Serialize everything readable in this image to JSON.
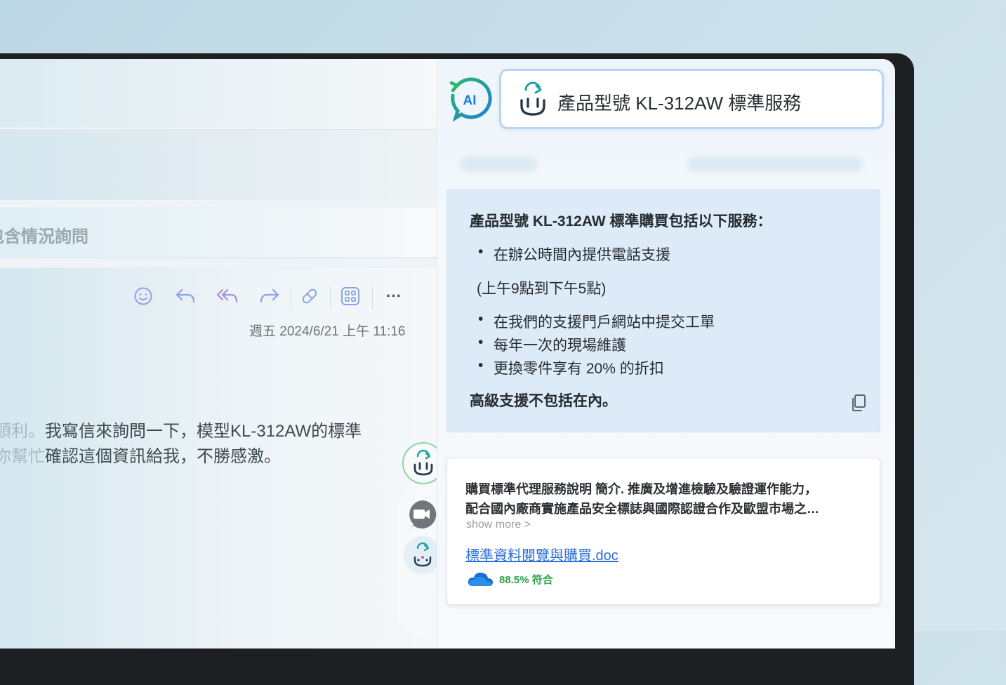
{
  "mail": {
    "subject": "包含情況詢問",
    "date": "週五 2024/6/21 上午 11:16",
    "body_line1_faded": "順利。",
    "body_line1": "我寫信來詢問一下，模型KL-312AW的標準",
    "body_line2_faded": "你幫忙",
    "body_line2": "確認這個資訊給我，不勝感激。",
    "toolbar_icons": [
      "smiley-icon",
      "reply-icon",
      "reply-all-icon",
      "forward-icon",
      "pill-icon",
      "apps-icon",
      "more-icon"
    ],
    "more_label": "···"
  },
  "panel": {
    "logo_text": "AI",
    "query": "產品型號 KL-312AW 標準服務",
    "answer": {
      "title": "產品型號 KL-312AW 標準購買包括以下服務：",
      "item1": "在辦公時間內提供電話支援",
      "note": "(上午9點到下午5點)",
      "items": [
        "在我們的支援門戶網站中提交工單",
        "每年一次的現場維護",
        "更換零件享有 20% 的折扣"
      ],
      "footer": "高級支援不包括在內。"
    },
    "source": {
      "line1": "購買標準代理服務說明 簡介. 推廣及增進檢驗及驗證運作能力，",
      "line2": "配合國內廠商實施產品安全標誌與國際認證合作及歐盟市場之…",
      "show_more": "show more >",
      "doc_name": "標準資料閱覽與購買.doc",
      "match": "88.5% 符合"
    }
  },
  "colors": {
    "accent_teal": "#1fa3a8",
    "accent_blue": "#2a6fd6",
    "match_green": "#2fa34a",
    "answer_bg": "#ddebf8"
  }
}
